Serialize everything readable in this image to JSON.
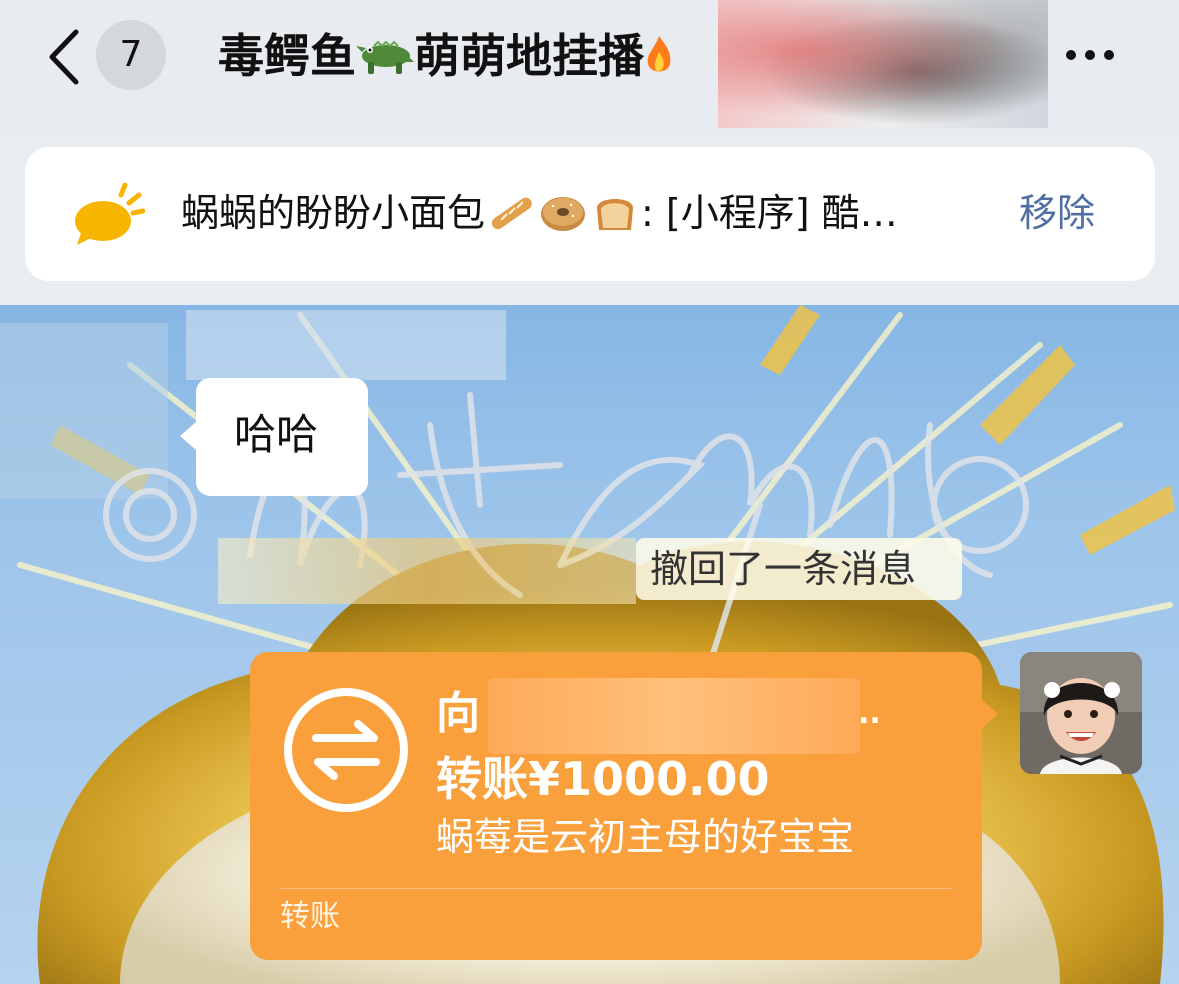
{
  "header": {
    "unread_count": "7",
    "title_part1": "毒鳄鱼",
    "title_part2": "萌萌地挂播",
    "title_icons": [
      "crocodile-emoji",
      "fire-emoji"
    ]
  },
  "pinned": {
    "sender": "蜗蜗的盼盼小面包",
    "sender_icons": [
      "baguette-emoji",
      "bagel-emoji",
      "bread-emoji"
    ],
    "message": ": [小程序] 酷…",
    "remove_label": "移除"
  },
  "chat": {
    "received_message": "哈哈",
    "system_notice": "撤回了一条消息",
    "transfer": {
      "recipient_prefix": "向",
      "recipient_suffix": "..",
      "amount": "转账¥1000.00",
      "note": "蜗莓是云初主母的好宝宝",
      "type_label": "转账"
    }
  },
  "colors": {
    "header_bg": "#e8ecf1",
    "transfer_orange": "#f9a03c",
    "remove_link": "#4f6fa3",
    "notice_yellow": "#f7b500"
  }
}
